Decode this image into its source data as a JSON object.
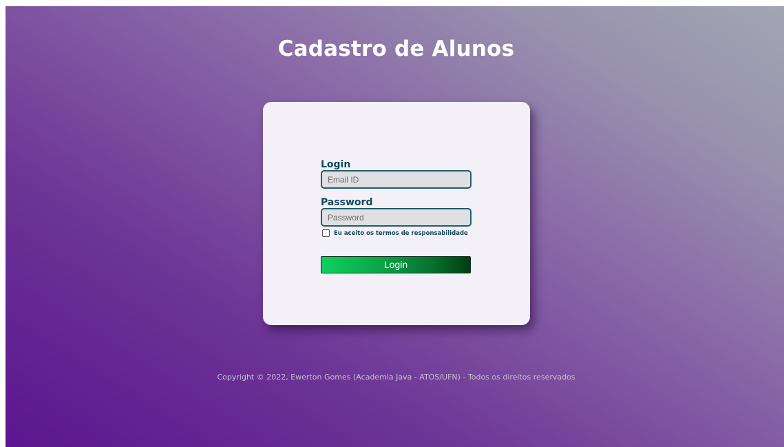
{
  "page": {
    "title": "Cadastro de Alunos"
  },
  "login_form": {
    "login_label": "Login",
    "email_placeholder": "Email ID",
    "password_label": "Password",
    "password_placeholder": "Password",
    "terms_label": "Eu aceito os termos de responsabilidade",
    "terms_checked": false,
    "submit_label": "Login"
  },
  "footer": {
    "copyright": "Copyright © 2022, Ewerton Gomes (Academia Java - ATOS/UFN) - Todos os direitos reservados"
  },
  "colors": {
    "background_start": "#5a168f",
    "background_end": "#a3a5b2",
    "card_background": "#f3f0f7",
    "label_color": "#14495a",
    "button_start": "#0fd15f",
    "button_end": "#033d14"
  }
}
